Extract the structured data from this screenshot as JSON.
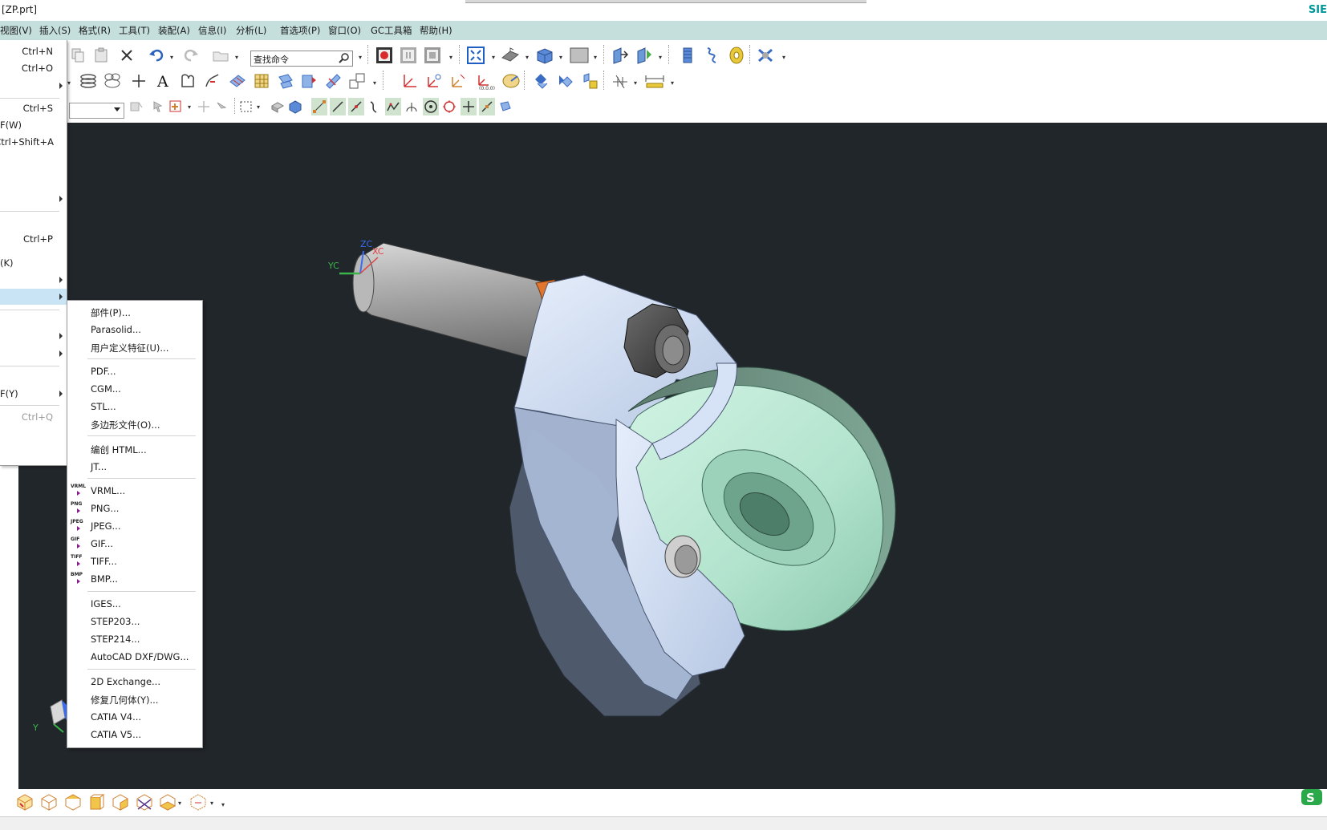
{
  "window": {
    "title": "[ZP.prt]",
    "brand": "SIE"
  },
  "menubar": {
    "items": [
      {
        "label": "视图(V)"
      },
      {
        "label": "插入(S)"
      },
      {
        "label": "格式(R)"
      },
      {
        "label": "工具(T)"
      },
      {
        "label": "装配(A)"
      },
      {
        "label": "信息(I)"
      },
      {
        "label": "分析(L)"
      },
      {
        "label": "首选项(P)"
      },
      {
        "label": "窗口(O)"
      },
      {
        "label": "GC工具箱"
      },
      {
        "label": "帮助(H)"
      }
    ]
  },
  "toolbar": {
    "search_placeholder": "查找命令"
  },
  "file_menu": {
    "items": [
      {
        "shortcut": "Ctrl+N"
      },
      {
        "shortcut": "Ctrl+O"
      },
      {
        "shortcut": "Ctrl+S"
      },
      {
        "label": "F(W)"
      },
      {
        "shortcut": "Ctrl+Shift+A"
      },
      {
        "shortcut": "Ctrl+P"
      },
      {
        "label": "(K)"
      },
      {
        "label": "F(Y)"
      },
      {
        "shortcut": "Ctrl+Q"
      }
    ]
  },
  "export_submenu": {
    "items": [
      {
        "label": "部件(P)..."
      },
      {
        "label": "Parasolid..."
      },
      {
        "label": "用户定义特征(U)..."
      },
      {
        "label": "PDF..."
      },
      {
        "label": "CGM..."
      },
      {
        "label": "STL..."
      },
      {
        "label": "多边形文件(O)..."
      },
      {
        "label": "编创 HTML..."
      },
      {
        "label": "JT..."
      },
      {
        "label": "VRML...",
        "icon_text": "VRML"
      },
      {
        "label": "PNG...",
        "icon_text": "PNG"
      },
      {
        "label": "JPEG...",
        "icon_text": "JPEG"
      },
      {
        "label": "GIF...",
        "icon_text": "GIF"
      },
      {
        "label": "TIFF...",
        "icon_text": "TIFF"
      },
      {
        "label": "BMP...",
        "icon_text": "BMP"
      },
      {
        "label": "IGES..."
      },
      {
        "label": "STEP203..."
      },
      {
        "label": "STEP214..."
      },
      {
        "label": "AutoCAD DXF/DWG..."
      },
      {
        "label": "2D Exchange..."
      },
      {
        "label": "修复几何体(Y)..."
      },
      {
        "label": "CATIA V4..."
      },
      {
        "label": "CATIA V5..."
      }
    ]
  },
  "viewport": {
    "triad": {
      "zc": "ZC",
      "xc": "XC",
      "yc": "YC"
    },
    "mini_triad": {
      "y": "Y"
    },
    "colors": {
      "background": "#21262a",
      "wheel": "#a8dcc5",
      "bracket": "#c9d9ef",
      "shaft": "#9a9a9a",
      "ring": "#e2762f",
      "nut": "#4a4a4a"
    }
  }
}
